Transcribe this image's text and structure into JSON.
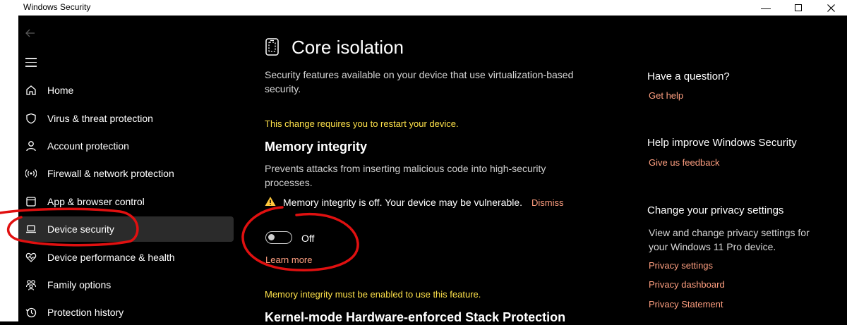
{
  "window": {
    "title": "Windows Security",
    "minimize": "—",
    "maximize": "☐",
    "close": "✕"
  },
  "sidebar": {
    "items": [
      {
        "label": "Home",
        "icon": "home-icon"
      },
      {
        "label": "Virus & threat protection",
        "icon": "shield-icon"
      },
      {
        "label": "Account protection",
        "icon": "person-icon"
      },
      {
        "label": "Firewall & network protection",
        "icon": "wifi-icon"
      },
      {
        "label": "App & browser control",
        "icon": "app-window-icon"
      },
      {
        "label": "Device security",
        "icon": "laptop-icon",
        "selected": true
      },
      {
        "label": "Device performance & health",
        "icon": "heart-icon"
      },
      {
        "label": "Family options",
        "icon": "family-icon"
      },
      {
        "label": "Protection history",
        "icon": "history-icon"
      }
    ]
  },
  "main": {
    "title": "Core isolation",
    "description": "Security features available on your device that use virtualization-based security.",
    "restart_notice": "This change requires you to restart your device.",
    "memory_integrity": {
      "heading": "Memory integrity",
      "description": "Prevents attacks from inserting malicious code into high-security processes.",
      "alert": "Memory integrity is off. Your device may be vulnerable.",
      "dismiss": "Dismiss",
      "toggle_state": "Off",
      "learn_more": "Learn more",
      "feature_notice": "Memory integrity must be enabled to use this feature."
    },
    "kernel_heading": "Kernel-mode Hardware-enforced Stack Protection"
  },
  "right": {
    "question_heading": "Have a question?",
    "get_help": "Get help",
    "improve_heading": "Help improve Windows Security",
    "feedback": "Give us feedback",
    "privacy_heading": "Change your privacy settings",
    "privacy_text": "View and change privacy settings for your Windows 11 Pro device.",
    "privacy_links": [
      "Privacy settings",
      "Privacy dashboard",
      "Privacy Statement"
    ]
  },
  "colors": {
    "accent_link": "#ff9f80",
    "warning": "#ffe24a",
    "annotation": "#e01010"
  }
}
